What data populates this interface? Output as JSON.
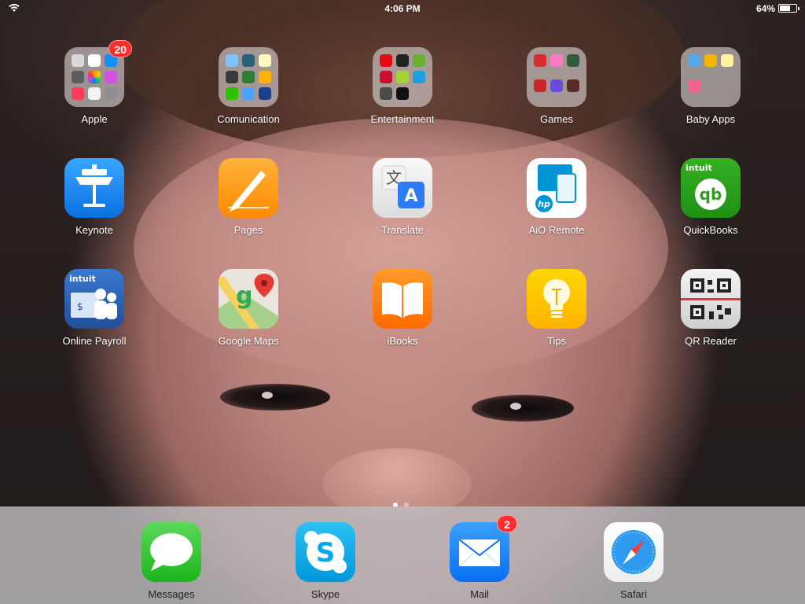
{
  "status_bar": {
    "time": "4:06 PM",
    "battery_text": "64%",
    "battery_level": 0.64,
    "wifi_icon": "wifi-icon"
  },
  "apps": {
    "apple": {
      "label": "Apple",
      "badge": "20"
    },
    "comunication": {
      "label": "Comunication"
    },
    "entertainment": {
      "label": "Entertainment"
    },
    "games": {
      "label": "Games"
    },
    "baby_apps": {
      "label": "Baby Apps"
    },
    "keynote": {
      "label": "Keynote",
      "color": "#1f8ef1"
    },
    "pages": {
      "label": "Pages",
      "color": "#ff9500"
    },
    "translate": {
      "label": "Translate",
      "color": "#2f7bf5"
    },
    "aio_remote": {
      "label": "AiO Remote",
      "color": "#0096d6"
    },
    "quickbooks": {
      "label": "QuickBooks",
      "color": "#2ca01c",
      "brand": "intuit"
    },
    "online_payroll": {
      "label": "Online Payroll",
      "color": "#2a63b8",
      "brand": "intuit"
    },
    "google_maps": {
      "label": "Google Maps"
    },
    "ibooks": {
      "label": "iBooks",
      "color": "#ff7a12"
    },
    "tips": {
      "label": "Tips",
      "color": "#ffcc00"
    },
    "qr_reader": {
      "label": "QR Reader"
    }
  },
  "dock": {
    "messages": {
      "label": "Messages",
      "color": "#34c759"
    },
    "skype": {
      "label": "Skype",
      "color": "#00aff0"
    },
    "mail": {
      "label": "Mail",
      "badge": "2",
      "color": "#1a8cff"
    },
    "safari": {
      "label": "Safari"
    }
  },
  "page_indicator": {
    "pages": 2,
    "current": 1
  }
}
